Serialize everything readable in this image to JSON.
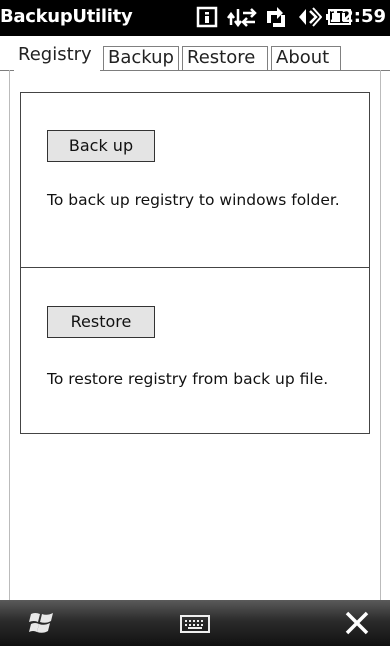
{
  "window": {
    "title": "BackupUtility"
  },
  "status_bar": {
    "icons": [
      "notification-icon",
      "connectivity-icon",
      "sync-icon",
      "volume-icon",
      "battery-icon"
    ],
    "time": "12:59"
  },
  "tabs": [
    {
      "label": "Registry",
      "active": true
    },
    {
      "label": "Backup",
      "active": false
    },
    {
      "label": "Restore",
      "active": false
    },
    {
      "label": "About",
      "active": false
    }
  ],
  "backup_panel": {
    "button_label": "Back up",
    "description": "To back up registry to windows folder."
  },
  "restore_panel": {
    "button_label": "Restore",
    "description": "To restore registry from back up file."
  },
  "taskbar": {
    "icons": [
      "windows-start-icon",
      "keyboard-icon",
      "close-icon"
    ]
  },
  "colors": {
    "title_bar": "#000000",
    "taskbar": "#2b2b2b",
    "button_face": "#e4e4e4",
    "background": "#ffffff"
  }
}
